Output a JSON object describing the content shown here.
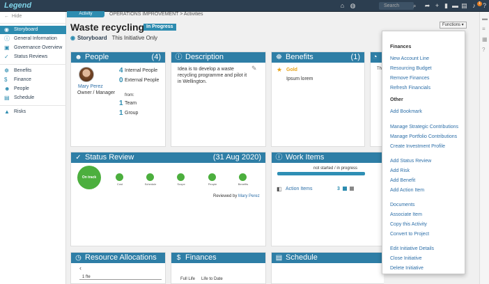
{
  "app": {
    "logo": "Legend"
  },
  "topbar": {
    "search_placeholder": "Search",
    "notification_count": "1",
    "icons": [
      "home-icon",
      "globe-icon",
      "share-icon",
      "plus-icon",
      "bookmark-icon",
      "chat-icon",
      "document-icon",
      "bell-icon",
      "help-icon"
    ]
  },
  "sidebar": {
    "hide_label": "Hide",
    "items": [
      {
        "label": "Storyboard",
        "icon": "storyboard-icon"
      },
      {
        "label": "General Information",
        "icon": "info-icon"
      },
      {
        "label": "Governance Overview",
        "icon": "governance-icon"
      },
      {
        "label": "Status Reviews",
        "icon": "check-icon"
      },
      {
        "label": "Benefits",
        "icon": "benefits-icon"
      },
      {
        "label": "Finance",
        "icon": "dollar-icon"
      },
      {
        "label": "People",
        "icon": "people-icon"
      },
      {
        "label": "Schedule",
        "icon": "schedule-icon"
      },
      {
        "label": "Risks",
        "icon": "risk-icon"
      }
    ]
  },
  "breadcrumb": {
    "tab": "Activity",
    "path": "OPERATIONS IMPROVEMENT > Activities"
  },
  "page": {
    "title": "Waste recycling",
    "status": "In Progress",
    "subhead_label": "Storyboard",
    "subhead_text": "This Initiative Only",
    "functions_label": "Functions ▾"
  },
  "people": {
    "title": "People",
    "count": "(4)",
    "person_name": "Mary Perez",
    "person_role": "Owner / Manager",
    "internal_count": "4",
    "internal_label": "Internal People",
    "external_count": "0",
    "external_label": "External People",
    "from_label": "from:",
    "team_count": "1",
    "team_label": "Team",
    "group_count": "1",
    "group_label": "Group"
  },
  "description": {
    "title": "Description",
    "text_1": "Idea is to develop a waste",
    "text_2": "recycling programme and pilot it",
    "text_3": "in Wellington."
  },
  "benefits": {
    "title": "Benefits",
    "count": "(1)",
    "tier": "Gold",
    "item": "Ipsum lorem"
  },
  "partial_card_text": "Th",
  "status_review": {
    "title": "Status Review",
    "date": "(31 Aug 2020)",
    "overall": "On track",
    "dims": [
      "Cost",
      "Schedule",
      "Scope",
      "People",
      "Benefits"
    ],
    "reviewed_by_label": "Reviewed by",
    "reviewed_by_name": "Mary Perez",
    "status_color": "#4caf3e"
  },
  "work_items": {
    "title": "Work Items",
    "progress_label": "not started / in progress",
    "item_label": "Action Items",
    "item_count": "3"
  },
  "resource_allocations": {
    "title": "Resource Allocations",
    "row_label": "1 fte"
  },
  "finances": {
    "title": "Finances",
    "col_1": "Full Life",
    "col_2": "Life to Date"
  },
  "schedule": {
    "title": "Schedule"
  },
  "functions_menu": {
    "section_1": "Finances",
    "finance_items": [
      "New Account Line",
      "Resourcing Budget",
      "Remove Finances",
      "Refresh Financials"
    ],
    "section_2": "Other",
    "other_items": [
      "Add Bookmark",
      "Manage Strategic Contributions",
      "Manage Portfolio Contributions",
      "Create Investment Profile",
      "Add Status Review",
      "Add Risk",
      "Add Benefit",
      "Add Action Item",
      "Documents",
      "Associate Item",
      "Copy this Activity",
      "Convert to Project",
      "Edit Initiative Details",
      "Close Initiative",
      "Delete Initiative"
    ]
  },
  "colors": {
    "accent": "#2e7ea6",
    "status_green": "#4caf3e",
    "gold": "#e8a317",
    "nav_bg": "#2c3e50"
  }
}
